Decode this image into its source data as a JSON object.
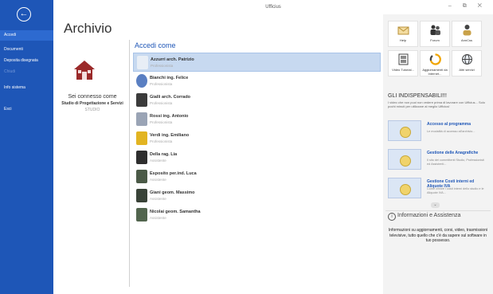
{
  "window": {
    "title": "Ufficius",
    "controls": "–  ⧉  ✕"
  },
  "sidebar": {
    "back_icon": "arrow-left-icon",
    "items": [
      {
        "label": "Accedi",
        "selected": true
      },
      {
        "label": "Documenti"
      },
      {
        "label": "Deposita disegnata"
      },
      {
        "label": "Chiudi",
        "disabled": true
      },
      {
        "label": "Info sistema"
      },
      {
        "label": "Esci"
      }
    ]
  },
  "archive": {
    "title": "Archivio",
    "status": "Sei connesso come",
    "studio_name": "Studio di Progettazione e Servizi",
    "studio_label": "STUDIO"
  },
  "accedi": {
    "title": "Accedi come",
    "users": [
      {
        "name": "Azzurri arch. Patrizio",
        "role": "Professionista",
        "selected": true
      },
      {
        "name": "Bianchi ing. Felice",
        "role": "Professionista"
      },
      {
        "name": "Gialli arch. Corrado",
        "role": "Professionista"
      },
      {
        "name": "Rossi ing. Antonio",
        "role": "Professionista"
      },
      {
        "name": "Verdi ing. Emiliano",
        "role": "Professionista"
      },
      {
        "name": "Della rag. Lia",
        "role": "Assistente"
      },
      {
        "name": "Esposito per.ind. Luca",
        "role": "Assistente"
      },
      {
        "name": "Giani geom. Massimo",
        "role": "Assistente"
      },
      {
        "name": "Nicolai geom. Samantha",
        "role": "Assistente"
      }
    ]
  },
  "tiles": [
    {
      "label": "Help",
      "icon": "help-envelope-icon"
    },
    {
      "label": "Forum",
      "icon": "forum-people-icon"
    },
    {
      "label": "AnnCss",
      "icon": "person-icon"
    },
    {
      "label": "Video Tutorial...",
      "icon": "film-icon"
    },
    {
      "label": "Aggiornamenti da Internet...",
      "icon": "update-arrows-icon"
    },
    {
      "label": "Altri servizi",
      "icon": "globe-icon"
    }
  ],
  "indispensabili": {
    "title": "GLI INDISPENSABILI!!!",
    "desc": "I video che non puoi non vedere prima di lavorare con Ufficius... Solo pochi minuti per utilizzare al meglio Ufficius!"
  },
  "promos": [
    {
      "title": "Accesso al programma",
      "desc": "Le modalità di accesso all'archivio..."
    },
    {
      "title": "Gestione delle Anagrafiche",
      "desc": "Il sito dei committenti Studio, Professionisti ed Assistenti..."
    },
    {
      "title": "Gestione Costi interni ed Aliquote IVA",
      "desc": "Come creare i costi interni dello studio e le Aliquote IVA..."
    }
  ],
  "info": {
    "title": "Informazioni e Assistenza",
    "text": "Informazioni su aggiornamenti, corsi, video, trasmissioni televisive, tutto quello che c'è da sapere sul software in tuo possesso."
  },
  "colors": {
    "accent": "#1e56b7",
    "selection": "#c7d9f0"
  }
}
